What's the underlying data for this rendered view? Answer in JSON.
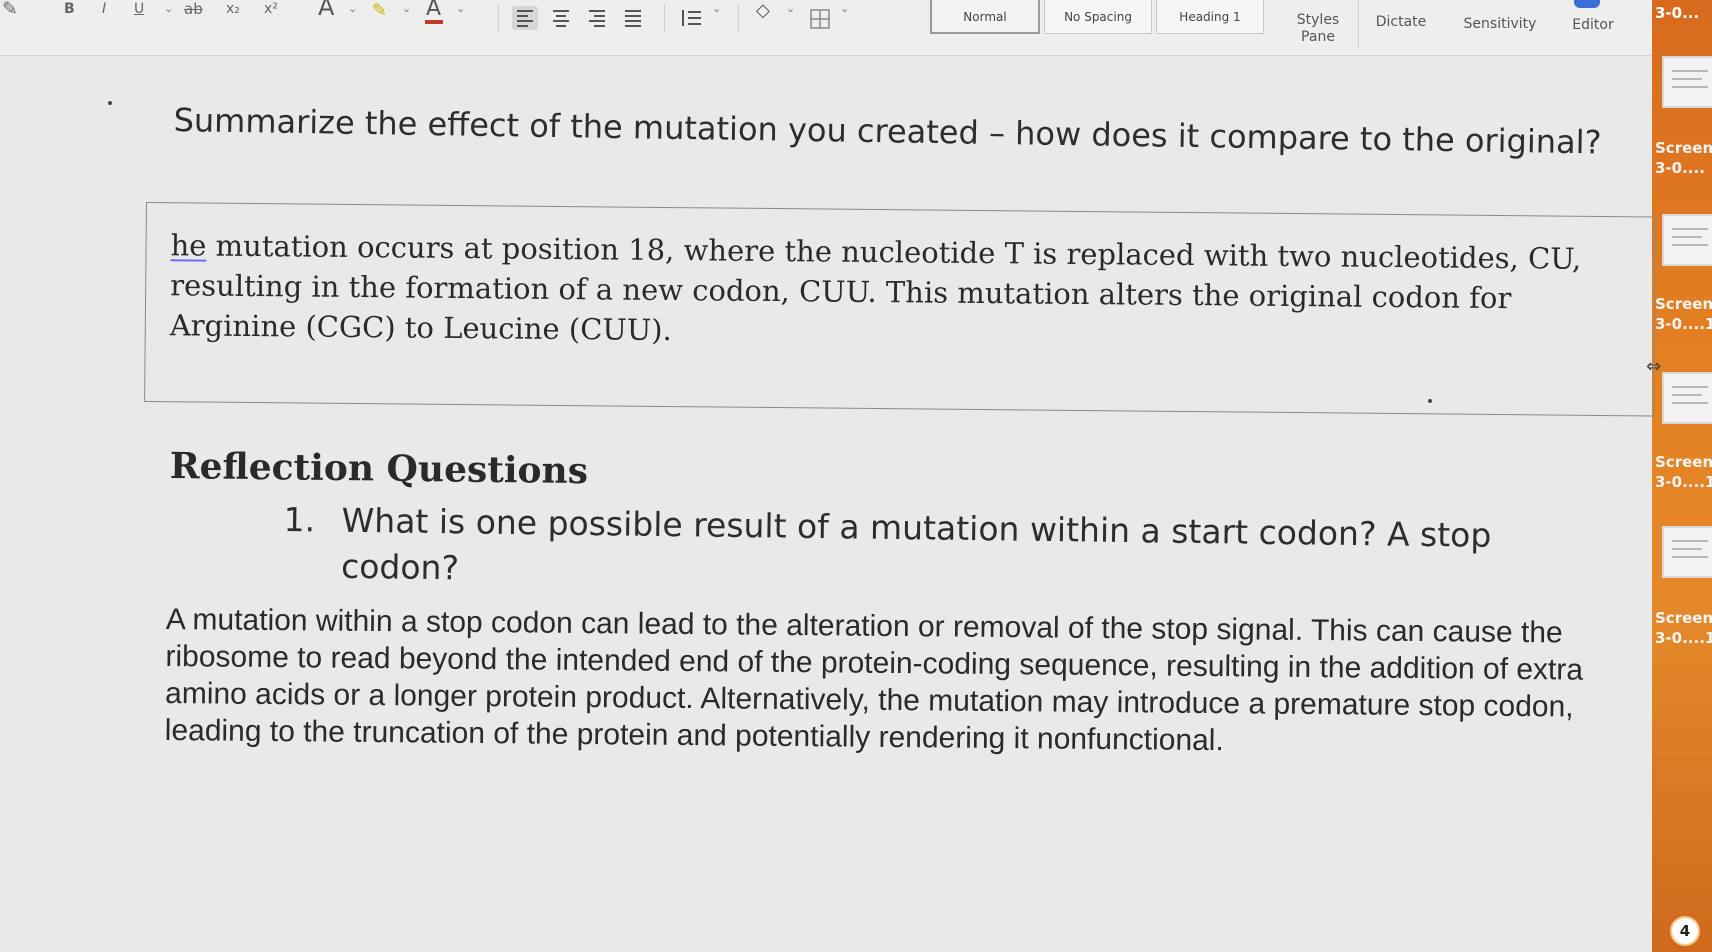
{
  "ribbon": {
    "format_labels": [
      "B",
      "I",
      "U",
      "ab",
      "x₂",
      "x²",
      "A"
    ],
    "styles": [
      "Normal",
      "No Spacing",
      "Heading 1"
    ],
    "styles_pane_label": "Styles\nPane",
    "dictate_label": "Dictate",
    "sensitivity_label": "Sensitivity",
    "editor_label": "Editor",
    "accent_color": "#c0392b"
  },
  "side_panel": {
    "top_label": "3-0...",
    "items": [
      {
        "line1": "Screen",
        "line2": "3-0...."
      },
      {
        "line1": "Screen",
        "line2": "3-0....1"
      },
      {
        "line1": "Screen",
        "line2": "3-0....1"
      },
      {
        "line1": "Screen",
        "line2": "3-0....1"
      }
    ],
    "badge": "4",
    "bg_color": "#e37f22"
  },
  "document": {
    "prompt": "Summarize the effect of the mutation you created – how does it compare to the original?",
    "answer_first_word": "he",
    "answer_rest": " mutation occurs at position 18, where the nucleotide T is replaced with two nucleotides, CU, resulting in the formation of a new codon, CUU. This mutation alters the original codon for Arginine (CGC) to Leucine (CUU).",
    "section_heading": "Reflection Questions",
    "question_number": "1.",
    "question_text": "What is one possible result of a mutation within a start codon?",
    "question_answer_inline": " A stop codon?",
    "answer2": "A mutation within a stop codon can lead to the alteration or removal of the stop signal. This can cause the ribosome to read beyond the intended end of the protein-coding sequence, resulting in the addition of extra amino acids or a longer protein product. Alternatively, the mutation may introduce a premature stop codon, leading to the truncation of the protein and potentially rendering it nonfunctional."
  }
}
